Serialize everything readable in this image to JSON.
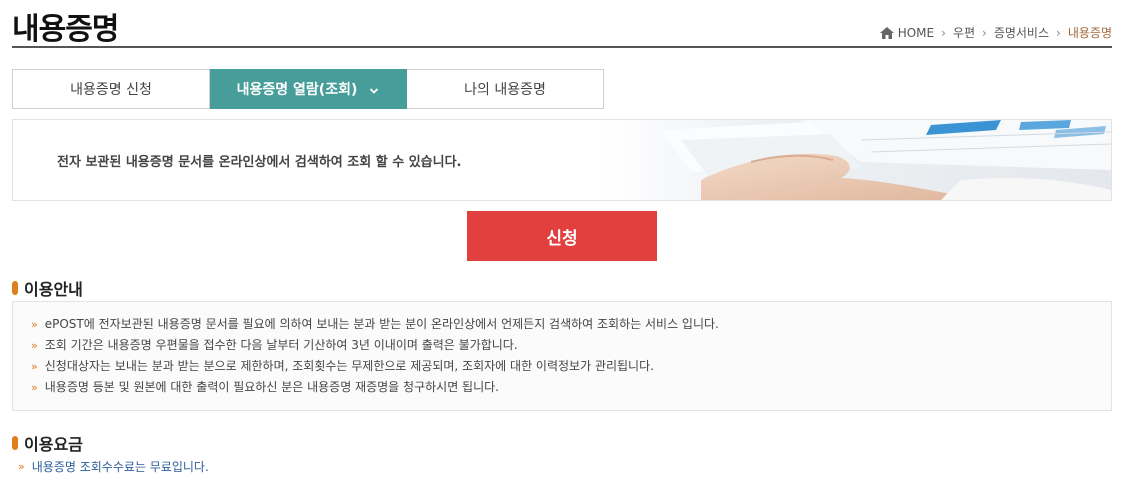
{
  "header": {
    "title": "내용증명"
  },
  "breadcrumb": {
    "home": "HOME",
    "items": [
      "우편",
      "증명서비스"
    ],
    "current": "내용증명"
  },
  "tabs": [
    {
      "label": "내용증명 신청",
      "active": false
    },
    {
      "label": "내용증명 열람(조회)",
      "active": true
    },
    {
      "label": "나의 내용증명",
      "active": false
    }
  ],
  "banner": {
    "text": "전자 보관된 내용증명 문서를 온라인상에서 검색하여 조회 할 수 있습니다."
  },
  "apply_button": {
    "label": "신청"
  },
  "usage_info": {
    "title": "이용안내",
    "items": [
      "ePOST에 전자보관된 내용증명 문서를 필요에 의하여 보내는 분과 받는 분이 온라인상에서 언제든지 검색하여 조회하는 서비스 입니다.",
      "조회 기간은 내용증명 우편물을 접수한 다음 날부터 기산하여 3년 이내이며 출력은 불가합니다.",
      "신청대상자는 보내는 분과 받는 분으로 제한하며, 조회횟수는 무제한으로 제공되며, 조회자에 대한 이력정보가 관리됩니다.",
      "내용증명 등본 및 원본에 대한 출력이 필요하신 분은 내용증명 재증명을 청구하시면 됩니다."
    ]
  },
  "usage_fee": {
    "title": "이용요금",
    "text": "내용증명 조회수수료는 무료입니다."
  },
  "colors": {
    "active_tab": "#479d99",
    "apply_button": "#e2403e",
    "accent": "#e07d1f",
    "breadcrumb_current": "#a5683a",
    "fee_text": "#2c5d9c"
  },
  "icons": {
    "home": "home-icon",
    "tab_chevron": "chevron-down-icon",
    "bullet_arrow": "chevron-right-icon"
  }
}
